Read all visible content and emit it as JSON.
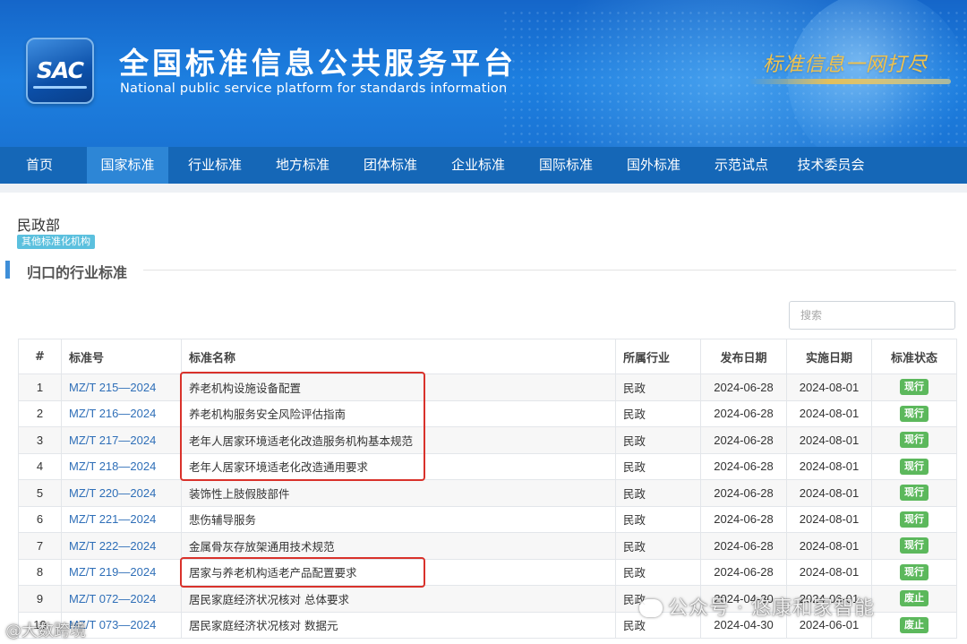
{
  "header": {
    "logo_text": "SAC",
    "title_cn": "全国标准信息公共服务平台",
    "title_en": "National public service platform  for standards information",
    "slogan": "标准信息一网打尽"
  },
  "nav": {
    "items": [
      {
        "label": "首页"
      },
      {
        "label": "国家标准"
      },
      {
        "label": "行业标准"
      },
      {
        "label": "地方标准"
      },
      {
        "label": "团体标准"
      },
      {
        "label": "企业标准"
      },
      {
        "label": "国际标准"
      },
      {
        "label": "国外标准"
      },
      {
        "label": "示范试点"
      },
      {
        "label": "技术委员会"
      }
    ],
    "active_index": 1
  },
  "org": {
    "name": "民政部",
    "tag": "其他标准化机构"
  },
  "section": {
    "title": "归口的行业标准"
  },
  "search": {
    "placeholder": "搜索"
  },
  "table": {
    "headers": [
      "#",
      "标准号",
      "标准名称",
      "所属行业",
      "发布日期",
      "实施日期",
      "标准状态"
    ],
    "rows": [
      {
        "idx": "1",
        "code": "MZ/T 215—2024",
        "name": "养老机构设施设备配置",
        "industry": "民政",
        "pub": "2024-06-28",
        "impl": "2024-08-01",
        "status": "现行"
      },
      {
        "idx": "2",
        "code": "MZ/T 216—2024",
        "name": "养老机构服务安全风险评估指南",
        "industry": "民政",
        "pub": "2024-06-28",
        "impl": "2024-08-01",
        "status": "现行"
      },
      {
        "idx": "3",
        "code": "MZ/T 217—2024",
        "name": "老年人居家环境适老化改造服务机构基本规范",
        "industry": "民政",
        "pub": "2024-06-28",
        "impl": "2024-08-01",
        "status": "现行"
      },
      {
        "idx": "4",
        "code": "MZ/T 218—2024",
        "name": "老年人居家环境适老化改造通用要求",
        "industry": "民政",
        "pub": "2024-06-28",
        "impl": "2024-08-01",
        "status": "现行"
      },
      {
        "idx": "5",
        "code": "MZ/T 220—2024",
        "name": "装饰性上肢假肢部件",
        "industry": "民政",
        "pub": "2024-06-28",
        "impl": "2024-08-01",
        "status": "现行"
      },
      {
        "idx": "6",
        "code": "MZ/T 221—2024",
        "name": "悲伤辅导服务",
        "industry": "民政",
        "pub": "2024-06-28",
        "impl": "2024-08-01",
        "status": "现行"
      },
      {
        "idx": "7",
        "code": "MZ/T 222—2024",
        "name": "金属骨灰存放架通用技术规范",
        "industry": "民政",
        "pub": "2024-06-28",
        "impl": "2024-08-01",
        "status": "现行"
      },
      {
        "idx": "8",
        "code": "MZ/T 219—2024",
        "name": "居家与养老机构适老产品配置要求",
        "industry": "民政",
        "pub": "2024-06-28",
        "impl": "2024-08-01",
        "status": "现行"
      },
      {
        "idx": "9",
        "code": "MZ/T 072—2024",
        "name": "居民家庭经济状况核对 总体要求",
        "industry": "民政",
        "pub": "2024-04-30",
        "impl": "2024-06-01",
        "status": "废止"
      },
      {
        "idx": "10",
        "code": "MZ/T 073—2024",
        "name": "居民家庭经济状况核对 数据元",
        "industry": "民政",
        "pub": "2024-04-30",
        "impl": "2024-06-01",
        "status": "废止"
      }
    ]
  },
  "colors": {
    "banner": "#1d7fe0",
    "nav": "#1567b7",
    "nav_active": "#2d86d6",
    "link": "#2f6fb8",
    "status_current": "#5cb85c",
    "highlight": "#d9322b"
  },
  "watermarks": {
    "right": "公众号 · 悠康和家智能",
    "left": "@大数跨境"
  }
}
